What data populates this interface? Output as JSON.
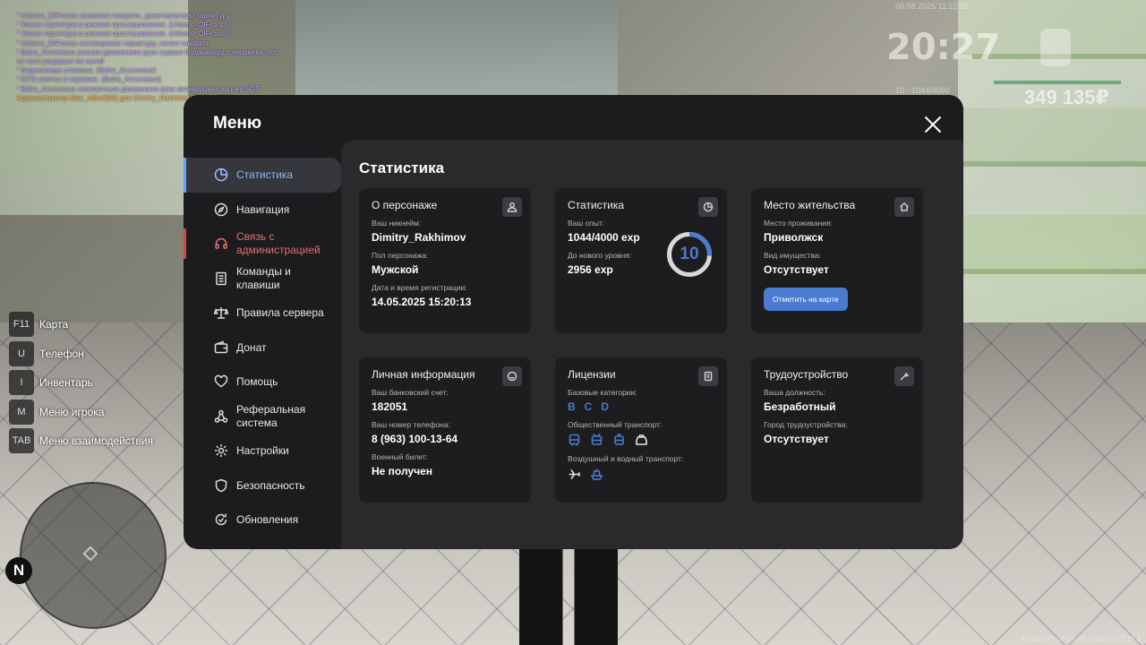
{
  "chat": [
    {
      "text": "* Urbano_DiFronzo закончил говорить, деактивировал гарнитуру",
      "color": "purple"
    },
    {
      "text": "* Умная гарнитура в режиме прослушивания. (Urbano_DiFronzo)",
      "color": "purple"
    },
    {
      "text": "* Умная гарнитура в режиме прослушивания. (Urbano_DiFronzo)",
      "color": "purple"
    },
    {
      "text": "* Urbano_DiFronzo активировал гарнитуру, начал говорить",
      "color": "purple"
    },
    {
      "text": "* Baha_Arceneaux резким движением руки сорвал бодикамеру с человека, пос",
      "color": "purple"
    },
    {
      "text": "ле чего раздавил ее ногой",
      "color": "purple"
    },
    {
      "text": "* Бодикамера сломана. (Baha_Arceneaux)",
      "color": "purple"
    },
    {
      "text": "* GPS маячок в кармане. (Baha_Arceneaux)",
      "color": "purple"
    },
    {
      "text": "* Baha_Arceneaux незаметным движением руки активировал кнопку SOS",
      "color": "purple"
    },
    {
      "text": "Администратор Max_Alfieri[98] для Dimitry_Rakhimov[2]: Без ЕПП)",
      "color": "orange"
    }
  ],
  "hud": {
    "date": "06.08.2025 11:22:55",
    "time": "20:27",
    "exp": "10 · 1044/4000",
    "money": "349 135₽"
  },
  "hints": [
    {
      "key": "F11",
      "label": "Карта"
    },
    {
      "key": "U",
      "label": "Телефон"
    },
    {
      "key": "I",
      "label": "Инвентарь"
    },
    {
      "key": "M",
      "label": "Меню игрока"
    },
    {
      "key": "TAB",
      "label": "Меню взаимодействия"
    }
  ],
  "minimap": {
    "north": "N"
  },
  "watermark": "Arizona Province #5 | build 6.3.2.10.3",
  "menu": {
    "title": "Меню",
    "nav": [
      {
        "label": "Статистика",
        "icon": "pie-chart-icon"
      },
      {
        "label": "Навигация",
        "icon": "compass-icon"
      },
      {
        "label": "Связь с администрацией",
        "icon": "headset-icon"
      },
      {
        "label": "Команды и клавиши",
        "icon": "document-icon"
      },
      {
        "label": "Правила сервера",
        "icon": "scales-icon"
      },
      {
        "label": "Донат",
        "icon": "wallet-icon"
      },
      {
        "label": "Помощь",
        "icon": "heart-hand-icon"
      },
      {
        "label": "Реферальная система",
        "icon": "network-icon"
      },
      {
        "label": "Настройки",
        "icon": "gear-icon"
      },
      {
        "label": "Безопасность",
        "icon": "shield-icon"
      },
      {
        "label": "Обновления",
        "icon": "refresh-check-icon"
      }
    ]
  },
  "content": {
    "title": "Статистика",
    "character": {
      "title": "О персонаже",
      "nick_label": "Ваш никнейм:",
      "nick": "Dimitry_Rakhimov",
      "gender_label": "Пол персонажа:",
      "gender": "Мужской",
      "reg_label": "Дата и время регистрации:",
      "reg": "14.05.2025 15:20:13"
    },
    "stats": {
      "title": "Статистика",
      "exp_label": "Ваш опыт:",
      "exp": "1044/4000 exp",
      "next_label": "До нового уровня:",
      "next": "2956 exp",
      "level": "10",
      "progress": 0.261
    },
    "residence": {
      "title": "Место жительства",
      "place_label": "Место проживания:",
      "place": "Приволжск",
      "property_label": "Вид имущества:",
      "property": "Отсутствует",
      "button": "Отметить на карте"
    },
    "personal": {
      "title": "Личная информация",
      "bank_label": "Ваш банковский счет:",
      "bank": "182051",
      "phone_label": "Ваш номер телефона:",
      "phone": "8 (963) 100-13-64",
      "military_label": "Военный билет:",
      "military": "Не получен"
    },
    "licenses": {
      "title": "Лицензии",
      "base_label": "Базовые категории:",
      "base": [
        "B",
        "C",
        "D"
      ],
      "public_label": "Общественный транспорт:",
      "air_label": "Воздушный и водный транспорт:"
    },
    "employment": {
      "title": "Трудоустройство",
      "position_label": "Ваша должность:",
      "position": "Безработный",
      "city_label": "Город трудоустройства:",
      "city": "Отсутствует"
    }
  },
  "colors": {
    "accent": "#4a7bd0",
    "alert": "#d64545",
    "panel": "#1c1c1f"
  }
}
